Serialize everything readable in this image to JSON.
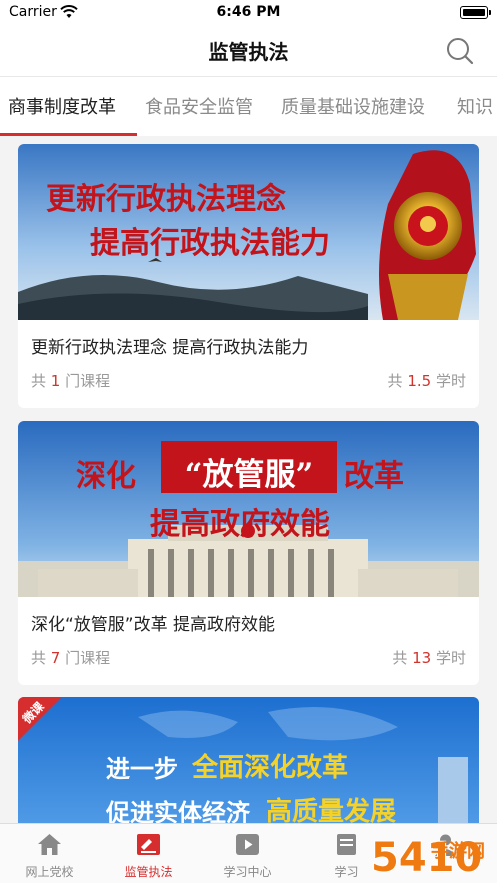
{
  "status_bar": {
    "carrier": "Carrier",
    "time": "6:46 PM"
  },
  "nav": {
    "title": "监管执法"
  },
  "tabs": [
    "商事制度改革",
    "食品安全监管",
    "质量基础设施建设",
    "知识"
  ],
  "cards": [
    {
      "banner_lines": [
        "更新行政执法理念",
        "提高行政执法能力"
      ],
      "title": "更新行政执法理念 提高行政执法能力",
      "course_prefix": "共",
      "course_count": "1",
      "course_suffix": "门课程",
      "hours_prefix": "共",
      "hours_value": "1.5",
      "hours_suffix": "学时"
    },
    {
      "banner_lines": [
        "深化",
        "“放管服”",
        "改革",
        "提高政府效能"
      ],
      "title": "深化“放管服”改革 提高政府效能",
      "course_prefix": "共",
      "course_count": "7",
      "course_suffix": "门课程",
      "hours_prefix": "共",
      "hours_value": "13",
      "hours_suffix": "学时"
    },
    {
      "banner_tag": "微课",
      "banner_lines": [
        "进一步",
        "全面深化改革",
        "促进实体经济",
        "高质量发展"
      ]
    }
  ],
  "tabbar": [
    {
      "label": "网上党校",
      "icon": "home-icon"
    },
    {
      "label": "监管执法",
      "icon": "enforcement-icon",
      "active": true
    },
    {
      "label": "学习中心",
      "icon": "video-play-icon"
    },
    {
      "label": "学习",
      "icon": "study-icon"
    },
    {
      "label": "",
      "icon": "profile-icon"
    }
  ],
  "watermark": {
    "text": "手游网",
    "brand": "5410"
  },
  "colors": {
    "accent": "#d62e2e",
    "number": "#d0342c",
    "muted": "#999999"
  }
}
